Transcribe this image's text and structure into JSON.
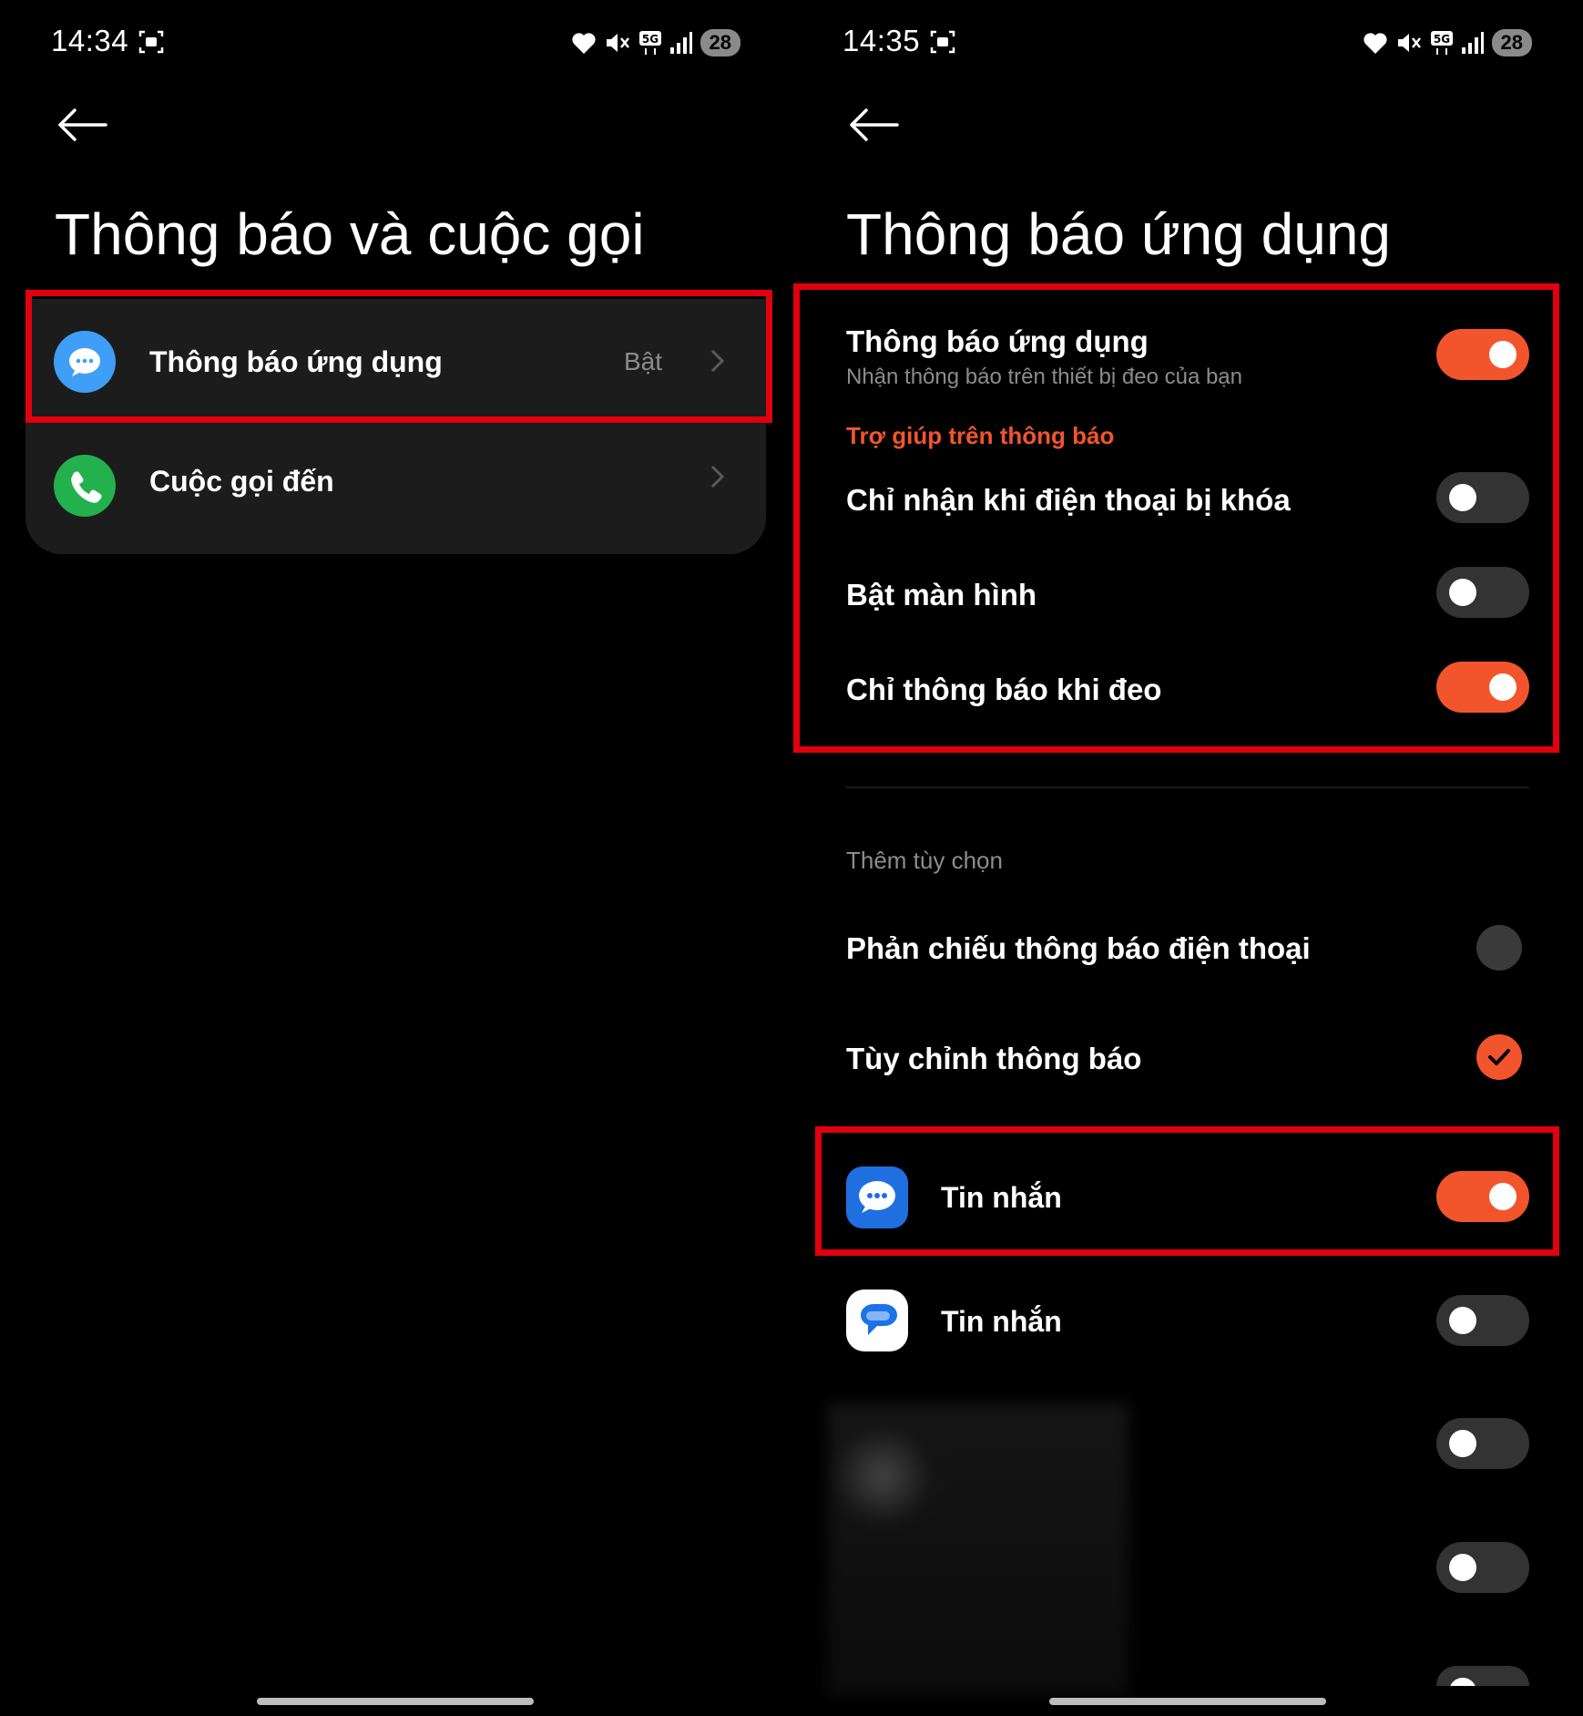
{
  "left": {
    "status": {
      "time": "14:34",
      "battery": "28"
    },
    "title": "Thông báo và cuộc gọi",
    "items": [
      {
        "label": "Thông báo ứng dụng",
        "value": "Bật"
      },
      {
        "label": "Cuộc gọi đến"
      }
    ]
  },
  "right": {
    "status": {
      "time": "14:35",
      "battery": "28"
    },
    "title": "Thông báo ứng dụng",
    "main_toggle": {
      "title": "Thông báo ứng dụng",
      "subtitle": "Nhận thông báo trên thiết bị đeo của bạn",
      "on": true
    },
    "section_header": "Trợ giúp trên thông báo",
    "options": [
      {
        "label": "Chỉ nhận khi điện thoại bị khóa",
        "on": false
      },
      {
        "label": "Bật màn hình",
        "on": false
      },
      {
        "label": "Chỉ thông báo khi đeo",
        "on": true
      }
    ],
    "more_header": "Thêm tùy chọn",
    "radios": [
      {
        "label": "Phản chiếu thông báo điện thoại",
        "selected": false
      },
      {
        "label": "Tùy chỉnh thông báo",
        "selected": true
      }
    ],
    "apps": [
      {
        "label": "Tin nhắn",
        "icon": "samsung-messages-icon",
        "on": true
      },
      {
        "label": "Tin nhắn",
        "icon": "google-messages-icon",
        "on": false
      },
      {
        "label": "",
        "icon": "blurred-app-icon",
        "on": false
      },
      {
        "label": "",
        "icon": "blurred-app-icon",
        "on": false
      }
    ]
  },
  "colors": {
    "accent": "#f2552c",
    "highlight": "#e0000e",
    "toggle_off": "#333333"
  }
}
